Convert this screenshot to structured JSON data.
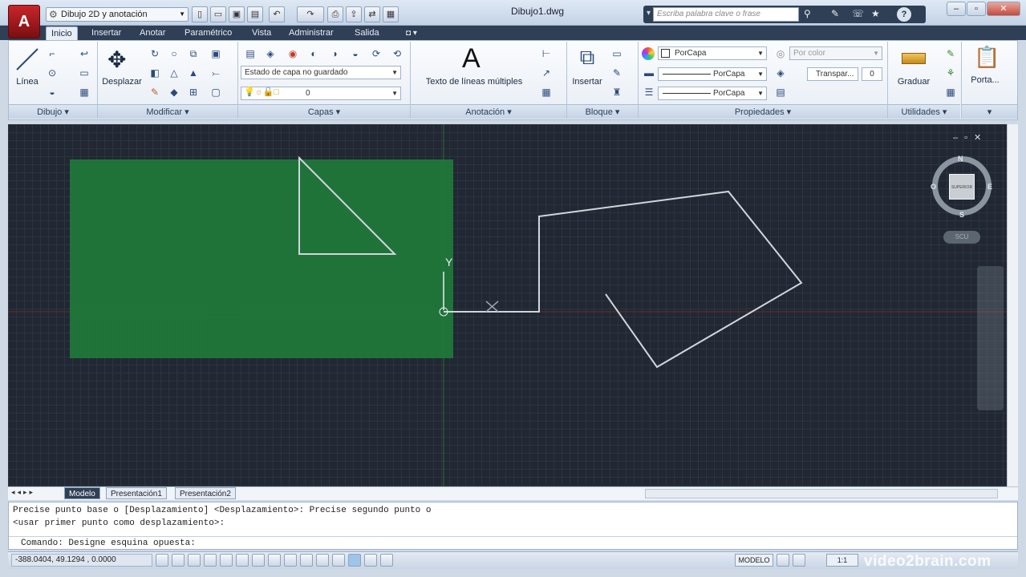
{
  "title_bar": {
    "workspace": "Dibujo 2D y anotación",
    "file_title": "Dibujo1.dwg",
    "search_placeholder": "Escriba palabra clave o frase",
    "help": "?"
  },
  "menu_tabs": [
    "Inicio",
    "Insertar",
    "Anotar",
    "Paramétrico",
    "Vista",
    "Administrar",
    "Salida"
  ],
  "ribbon": {
    "dibujo": {
      "title": "Dibujo",
      "linea_label": "Línea"
    },
    "modificar": {
      "title": "Modificar",
      "desplazar_label": "Desplazar"
    },
    "capas": {
      "title": "Capas",
      "layer_state": "Estado de capa no guardado",
      "current_layer": "0"
    },
    "anotacion": {
      "title": "Anotación",
      "mtext_label": "Texto de líneas múltiples",
      "mtext_glyph": "A"
    },
    "bloque": {
      "title": "Bloque",
      "insertar_label": "Insertar"
    },
    "propiedades": {
      "title": "Propiedades",
      "color": "PorCapa",
      "linetype": "PorCapa",
      "lineweight": "PorCapa",
      "plot_style": "Por color",
      "transparency_label": "Transpar...",
      "transparency_value": "0"
    },
    "utilidades": {
      "title": "Utilidades",
      "graduar_label": "Graduar"
    },
    "portapapeles": {
      "label": "Porta..."
    }
  },
  "viewcube": {
    "north": "N",
    "south": "S",
    "east": "E",
    "west": "O",
    "face": "SUPERIOR",
    "wcs": "SCU"
  },
  "ucs_labels": {
    "y": "Y",
    "x": "X"
  },
  "layout_tabs": [
    "Modelo",
    "Presentación1",
    "Presentación2"
  ],
  "command": {
    "history_1": "Precise punto base o [Desplazamiento] <Desplazamiento>: Precise segundo punto o",
    "history_2": "<usar primer punto como desplazamiento>:",
    "prompt": "Comando: Designe esquina opuesta:"
  },
  "status": {
    "coords": "-388.0404, 49.1294 , 0.0000",
    "space": "MODELO",
    "scale": "1:1"
  },
  "watermark": "video2brain.com",
  "colors": {
    "selection_fill": "#1f7a3a",
    "drawing_lines": "#cfd6dc",
    "background": "#212833"
  }
}
